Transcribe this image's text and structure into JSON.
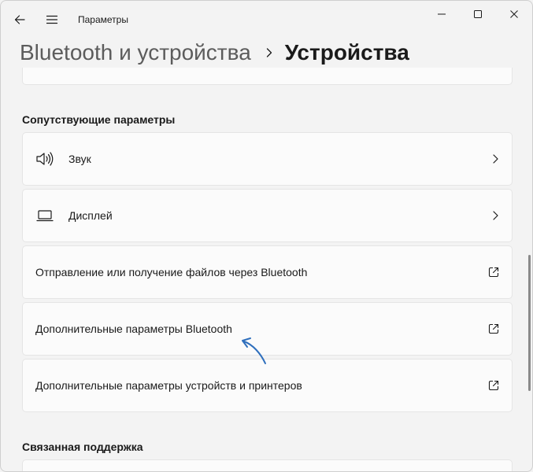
{
  "app": {
    "title": "Параметры"
  },
  "breadcrumb": {
    "parent": "Bluetooth и устройства",
    "current": "Устройства"
  },
  "related_settings": {
    "title": "Сопутствующие параметры",
    "items": [
      {
        "label": "Звук",
        "icon": "speaker-icon",
        "trail": "chevron-right-icon"
      },
      {
        "label": "Дисплей",
        "icon": "monitor-icon",
        "trail": "chevron-right-icon"
      },
      {
        "label": "Отправление или получение файлов через Bluetooth",
        "trail": "open-external-icon"
      },
      {
        "label": "Дополнительные параметры Bluetooth",
        "trail": "open-external-icon"
      },
      {
        "label": "Дополнительные параметры устройств и принтеров",
        "trail": "open-external-icon"
      }
    ]
  },
  "related_support": {
    "title": "Связанная поддержка"
  },
  "colors": {
    "accent_arrow": "#2f6fbd",
    "background": "#f3f3f3",
    "card": "#fbfbfb"
  }
}
